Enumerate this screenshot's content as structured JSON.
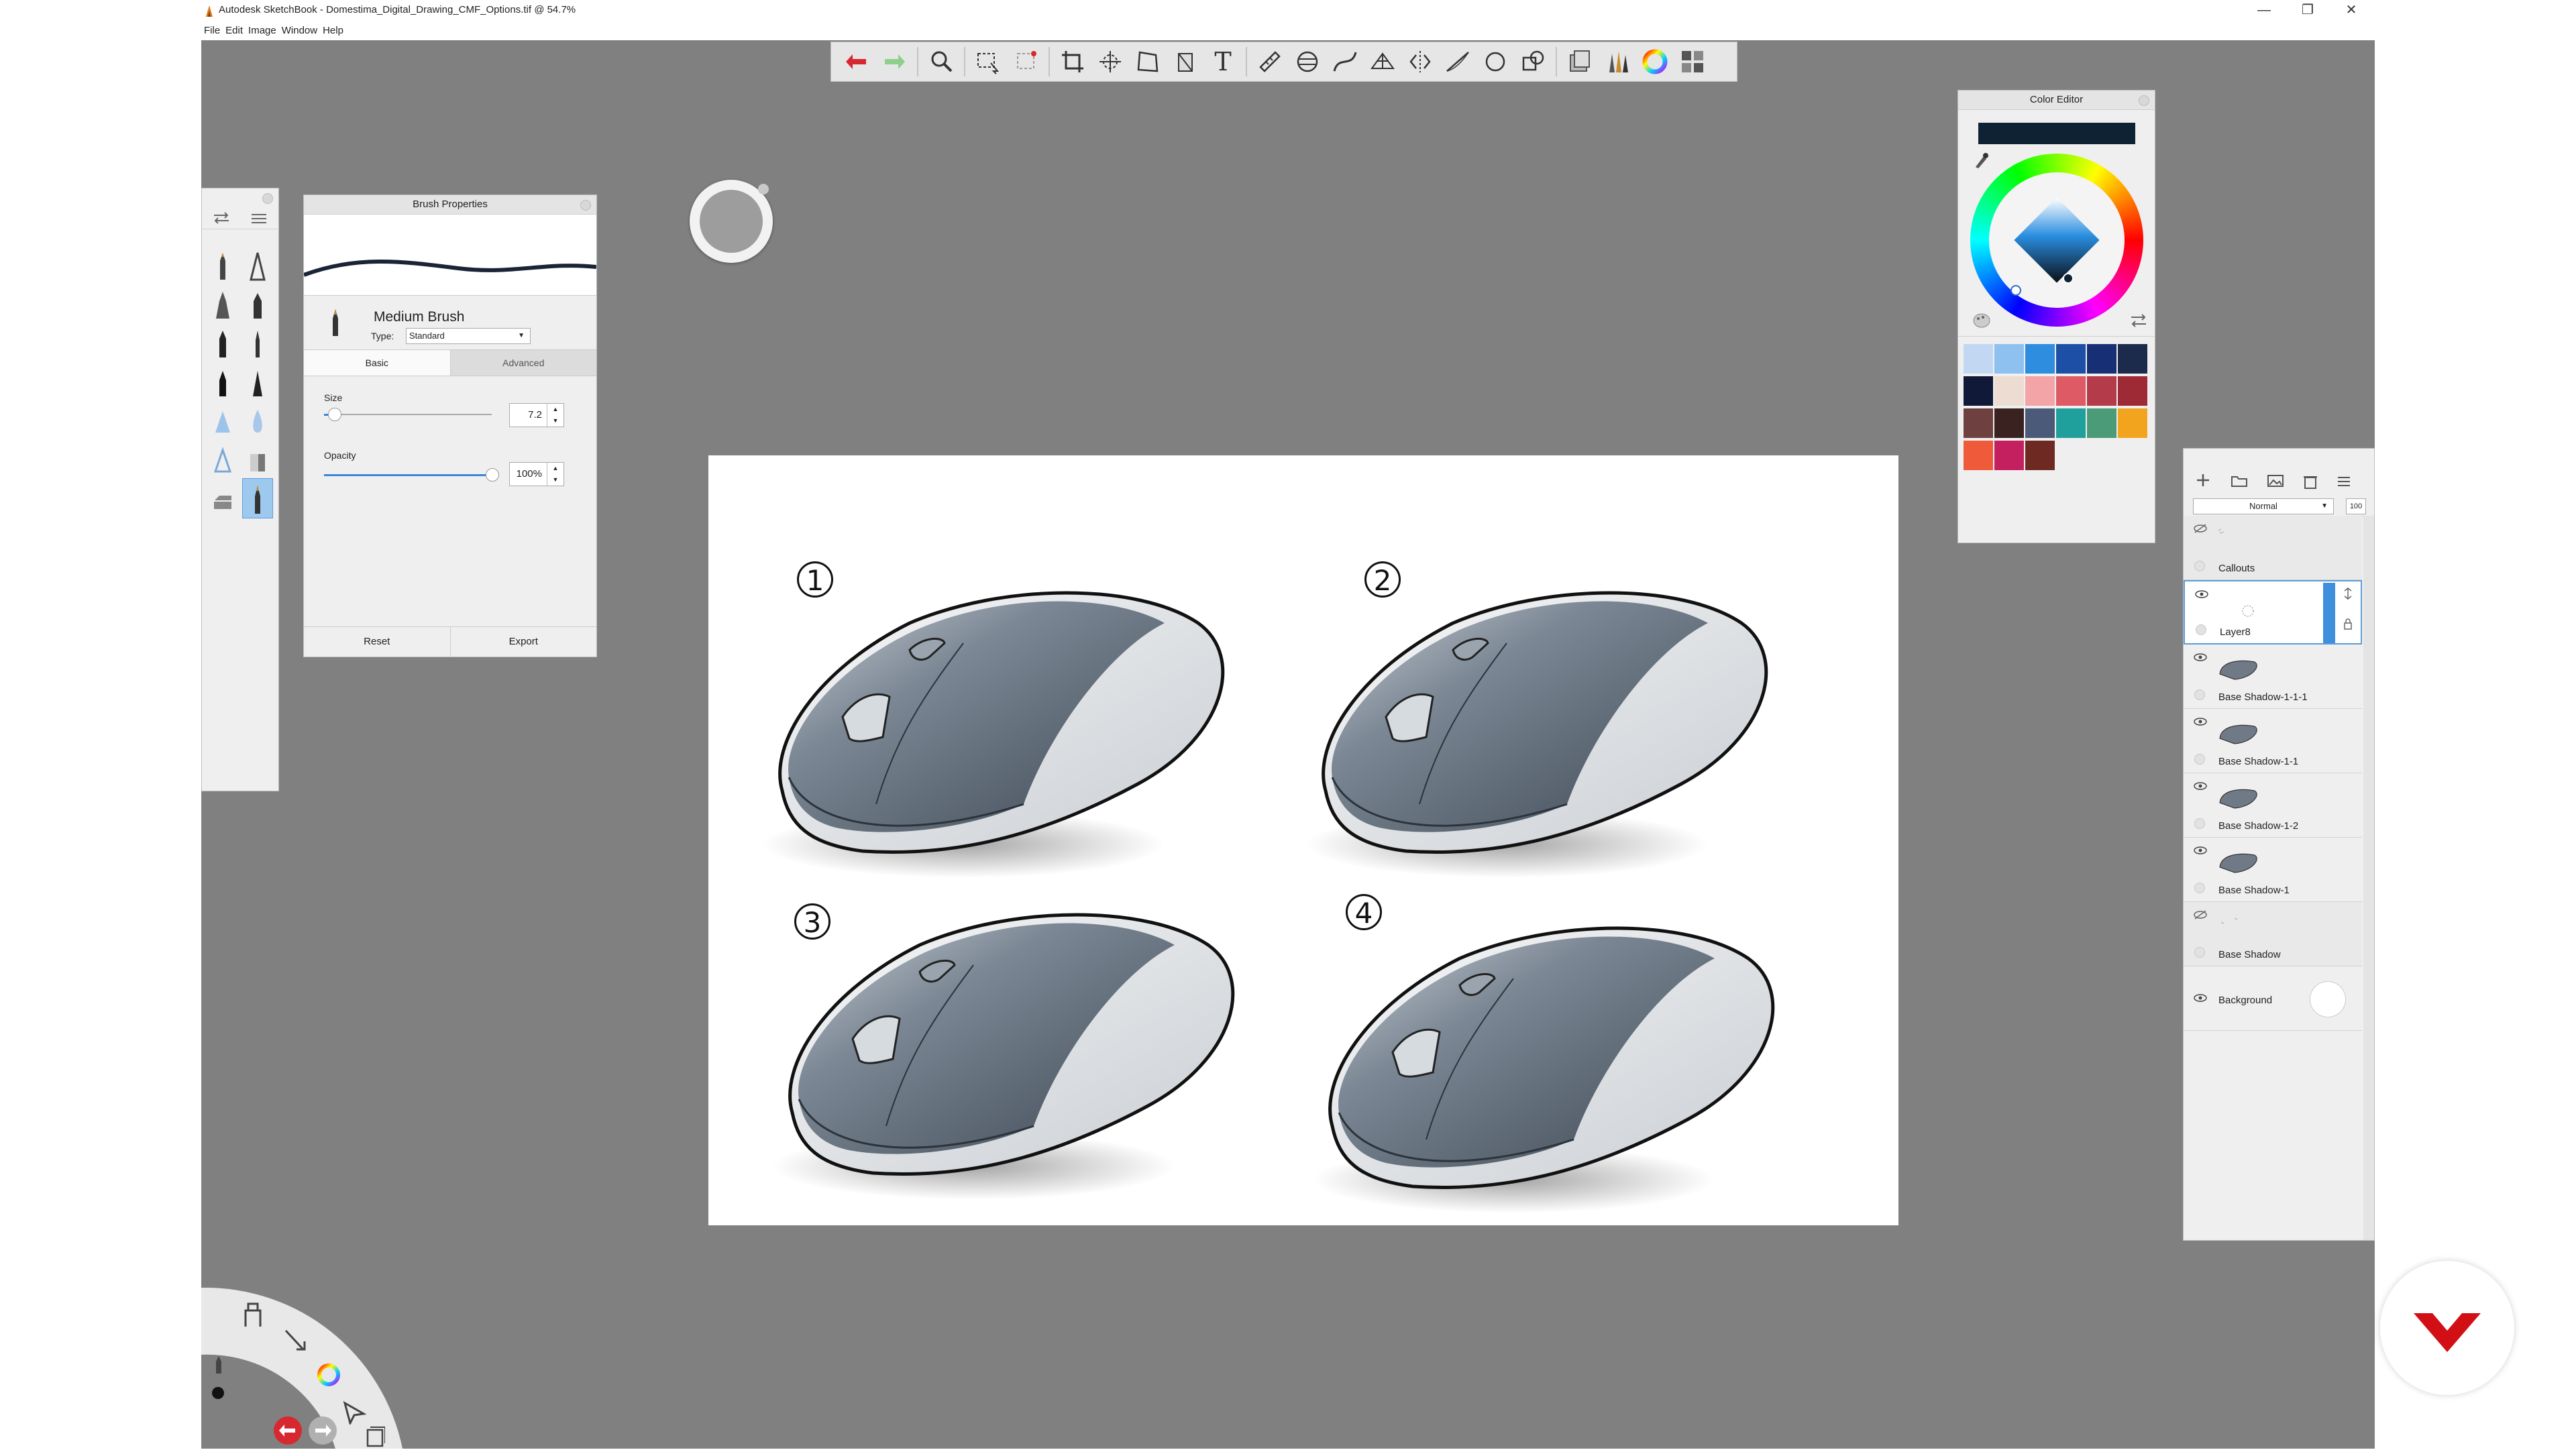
{
  "titlebar": {
    "title": "Autodesk SketchBook - Domestima_Digital_Drawing_CMF_Options.tif @ 54.7%",
    "minimize_glyph": "—",
    "restore_glyph": "❐",
    "close_glyph": "✕"
  },
  "menu": {
    "file": "File",
    "edit": "Edit",
    "image": "Image",
    "window": "Window",
    "help": "Help"
  },
  "toolbar": {
    "icons": [
      "undo-icon",
      "redo-icon",
      "zoom-icon",
      "select-icon",
      "lasso-select-icon",
      "crop-icon",
      "transform-icon",
      "distort-icon",
      "fill-icon",
      "text-icon",
      "ruler-icon",
      "ellipse-guide-icon",
      "french-curve-icon",
      "perspective-icon",
      "symmetry-icon",
      "stroke-tool-icon",
      "shape-icon",
      "copic-icon",
      "brush-library-icon",
      "color-wheel-icon",
      "copic-library-icon"
    ],
    "text_tool_glyph": "T"
  },
  "brush_properties": {
    "title": "Brush Properties",
    "brush_name": "Medium Brush",
    "type_label": "Type:",
    "type_value": "Standard",
    "tab_basic": "Basic",
    "tab_advanced": "Advanced",
    "size_label": "Size",
    "size_value": "7.2",
    "size_fraction": 0.06,
    "opacity_label": "Opacity",
    "opacity_value": "100%",
    "opacity_fraction": 1.0,
    "reset_label": "Reset",
    "export_label": "Export"
  },
  "color_editor": {
    "title": "Color Editor",
    "current_color": "#0f2233",
    "swatches": [
      "#c2d8f2",
      "#8fc1f0",
      "#2f8de0",
      "#1e4fa6",
      "#162f75",
      "#1c2a4c",
      "#101a38",
      "#eddcd2",
      "#f2a4a6",
      "#de5a64",
      "#b33b4a",
      "#9e2a36",
      "#6e4140",
      "#3a2220",
      "#4a5a78",
      "#1fa09c",
      "#4b9a78",
      "#f2a41e",
      "#ef5a3a",
      "#c42060",
      "#6e2a22"
    ]
  },
  "layers": {
    "blend_mode": "Normal",
    "opacity": "100",
    "items": [
      {
        "name": "Callouts",
        "visible": false
      },
      {
        "name": "Layer8",
        "visible": true,
        "selected": true
      },
      {
        "name": "Base Shadow-1-1-1",
        "visible": true
      },
      {
        "name": "Base Shadow-1-1",
        "visible": true
      },
      {
        "name": "Base Shadow-1-2",
        "visible": true
      },
      {
        "name": "Base Shadow-1",
        "visible": true
      },
      {
        "name": "Base Shadow",
        "visible": false
      },
      {
        "name": "Background",
        "visible": true
      }
    ]
  },
  "canvas": {
    "option_labels": [
      "1",
      "2",
      "3",
      "4"
    ]
  },
  "colors": {
    "workspace": "#808080",
    "selection": "#9ec9ef",
    "brand_red": "#d20f14"
  }
}
